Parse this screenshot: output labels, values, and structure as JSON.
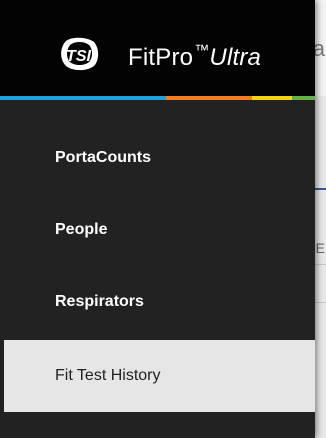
{
  "app": {
    "name": "FitPro",
    "trademark": "™",
    "edition": "Ultra",
    "logo_text": "TSI"
  },
  "brand_colors": [
    "#1ea3dc",
    "#f07d22",
    "#f3d40f",
    "#63b243"
  ],
  "nav": {
    "items": [
      {
        "label": "PortaCounts",
        "selected": false
      },
      {
        "label": "People",
        "selected": false
      },
      {
        "label": "Respirators",
        "selected": false
      },
      {
        "label": "Fit Test History",
        "selected": true
      }
    ]
  },
  "background": {
    "fragment_top": "a",
    "fragment_mid": "E"
  }
}
